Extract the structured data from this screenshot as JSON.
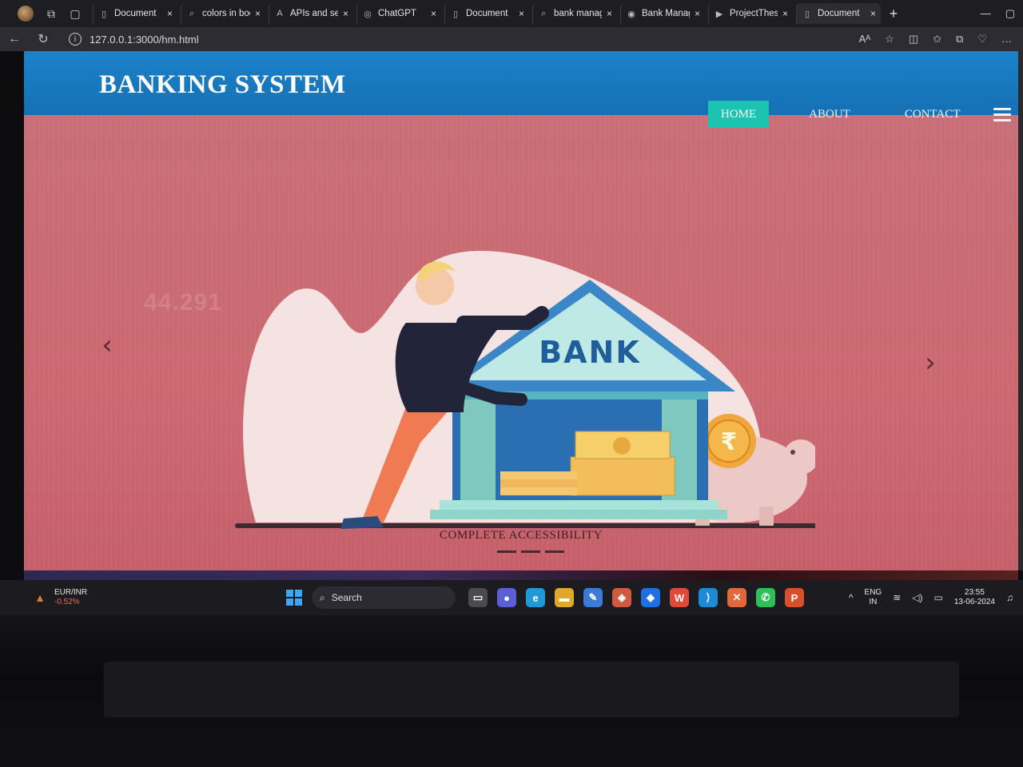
{
  "browser": {
    "tabs": [
      {
        "label": "Document",
        "icon": "page-icon",
        "active": false
      },
      {
        "label": "colors in boo",
        "icon": "search-icon",
        "active": false
      },
      {
        "label": "APIs and ser",
        "icon": "api-icon",
        "active": false
      },
      {
        "label": "ChatGPT",
        "icon": "chatgpt-icon",
        "active": false
      },
      {
        "label": "Document",
        "icon": "page-icon",
        "active": false
      },
      {
        "label": "bank manag",
        "icon": "search-icon",
        "active": false
      },
      {
        "label": "Bank Manag",
        "icon": "github-icon",
        "active": false
      },
      {
        "label": "ProjectThes",
        "icon": "youtube-icon",
        "active": false
      },
      {
        "label": "Document",
        "icon": "page-icon",
        "active": true
      }
    ],
    "url": "127.0.0.1:3000/hm.html"
  },
  "site": {
    "brand": "BANKING SYSTEM",
    "nav": [
      {
        "label": "HOME",
        "active": true
      },
      {
        "label": "ABOUT",
        "active": false
      },
      {
        "label": "CONTACT",
        "active": false
      }
    ],
    "hero": {
      "background_number": "44.291",
      "bank_sign": "BANK",
      "coin_symbol": "₹",
      "caption": "COMPLETE ACCESSIBILITY",
      "slide_count": 3,
      "active_slide": 1
    },
    "colors": {
      "navbar": "#1670b4",
      "nav_active": "#1cc3b0",
      "hero_bg": "#c96a72"
    }
  },
  "taskbar": {
    "widget_title": "EUR/INR",
    "widget_change": "-0.52%",
    "search_placeholder": "Search",
    "language_line1": "ENG",
    "language_line2": "IN",
    "time": "23:55",
    "date": "13-06-2024"
  }
}
